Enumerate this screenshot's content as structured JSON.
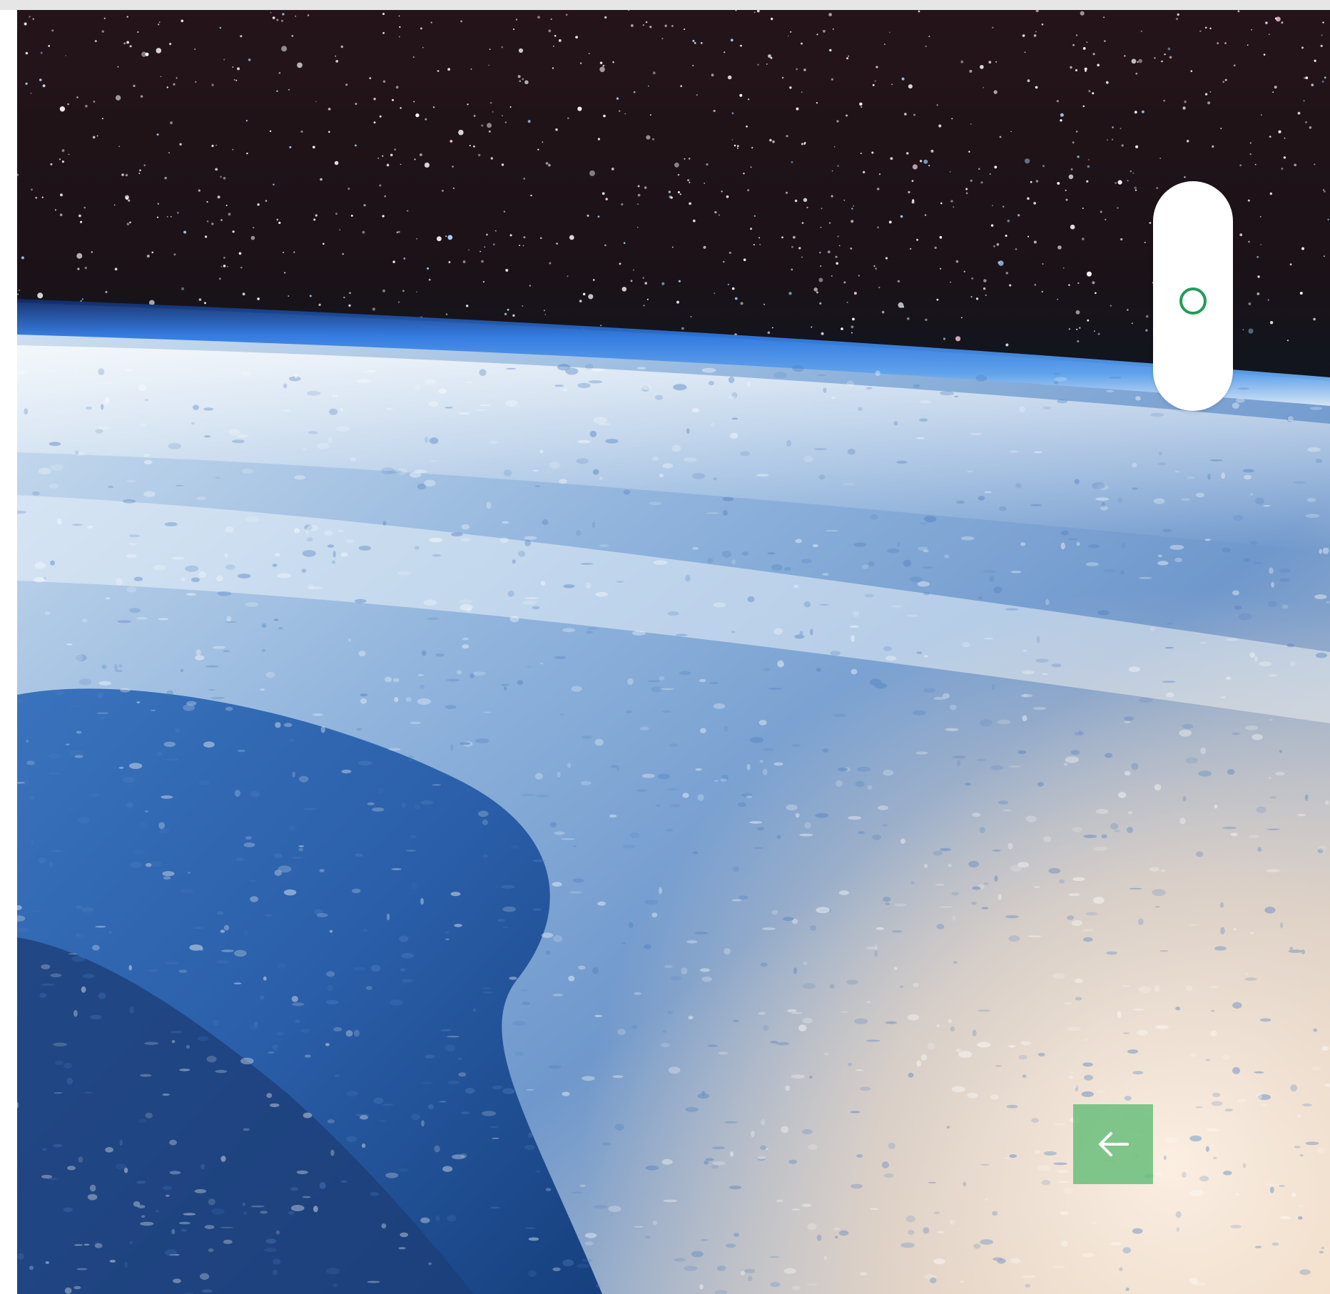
{
  "colors": {
    "accent": "#1f9d55",
    "back_button_bg": "#6abe7a",
    "top_bar": "#e6e6e6",
    "space": "#1b1217",
    "atmosphere": "#2f78e0",
    "ocean": "#2a5ea8",
    "clouds": "#e8f0f8",
    "sunlit": "#f2dcc6"
  },
  "hero": {
    "image_description_icon": "earth-from-space-image"
  },
  "slider": {
    "icon": "circle-outline-icon",
    "position": 0.5
  },
  "back_button": {
    "icon": "arrow-left-icon"
  }
}
